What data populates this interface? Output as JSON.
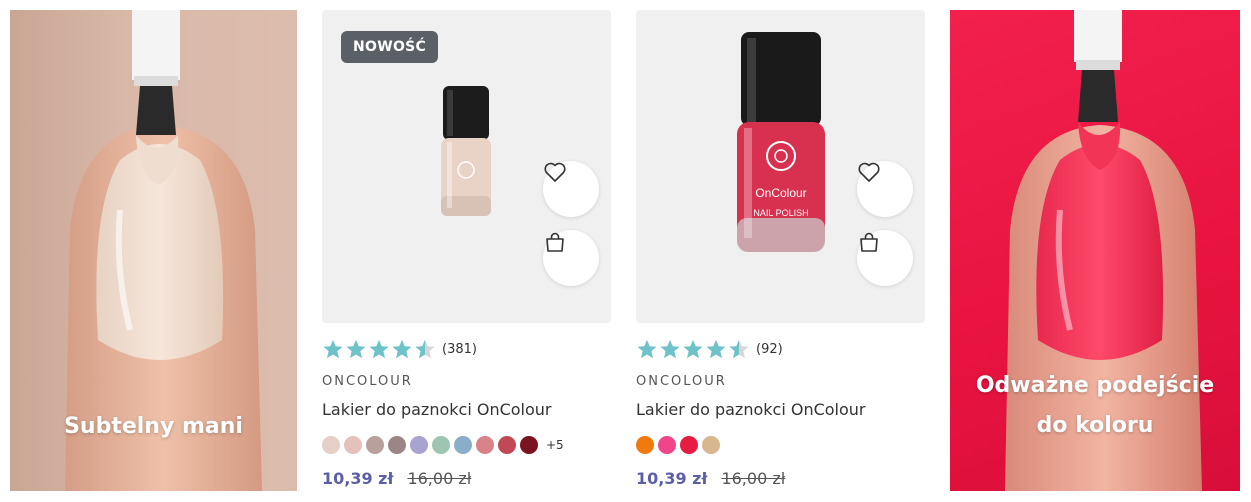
{
  "promos": {
    "left": {
      "caption": "Subtelny mani"
    },
    "right": {
      "caption_line1": "Odważne podejście",
      "caption_line2": "do koloru"
    }
  },
  "products": [
    {
      "badge": "NOWOŚĆ",
      "rating_count": "(381)",
      "rating": 4.5,
      "brand": "ONCOLOUR",
      "name": "Lakier do paznokci OnColour",
      "swatches": [
        "#e5d0c8",
        "#e6c1bb",
        "#b8a19d",
        "#9c8587",
        "#a9a4cf",
        "#9dc6b2",
        "#8aaec8",
        "#d98289",
        "#c04955",
        "#7a1420"
      ],
      "more_swatches": "+5",
      "price": "10,39 zł",
      "old_price": "16,00 zł",
      "icons": {
        "wishlist": "heart-icon",
        "cart": "shopping-bag-icon"
      }
    },
    {
      "rating_count": "(92)",
      "rating": 4.5,
      "brand": "ONCOLOUR",
      "name": "Lakier do paznokci OnColour",
      "bottle_text": {
        "brand": "OnColour",
        "sub": "NAIL POLISH"
      },
      "swatches": [
        "#f07a0c",
        "#f0458a",
        "#e61c43",
        "#d8b690"
      ],
      "price": "10,39 zł",
      "old_price": "16,00 zł",
      "icons": {
        "wishlist": "heart-icon",
        "cart": "shopping-bag-icon"
      }
    }
  ],
  "colors": {
    "star": "#6ec3c9",
    "price": "#5b5fa8",
    "badge_bg": "#5a6066"
  }
}
